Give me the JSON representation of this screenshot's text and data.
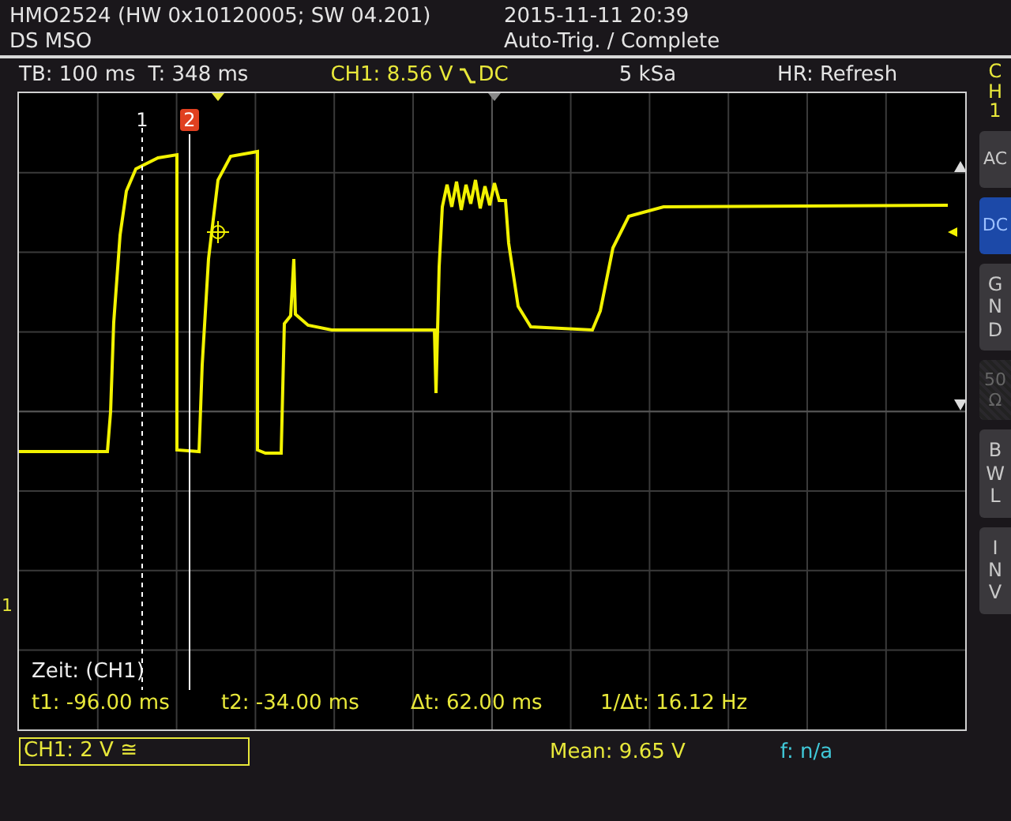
{
  "header": {
    "device": "HMO2524 (HW 0x10120005; SW 04.201)",
    "mode": "DS MSO",
    "datetime": "2015-11-11 20:39",
    "status": "Auto-Trig. / Complete"
  },
  "info_bar": {
    "timebase": "TB: 100 ms",
    "trigger_time": "T: 348 ms",
    "trigger_level": "CH1: 8.56 V",
    "trigger_coupling": "DC",
    "sample_rate": "5 kSa",
    "acquisition": "HR: Refresh"
  },
  "cursors": [
    {
      "label": "1",
      "kind": "dashed",
      "selected": false
    },
    {
      "label": "2",
      "kind": "solid",
      "selected": true
    }
  ],
  "ground_marker": "1",
  "measurements": {
    "title": "Zeit: (CH1)",
    "values": [
      "t1: -96.00 ms",
      "t2: -34.00 ms",
      "Δt: 62.00 ms",
      "1/Δt: 16.12 Hz"
    ]
  },
  "side_menu": {
    "channel": "CH1",
    "buttons": [
      {
        "label": "AC",
        "kind": "inline",
        "selected": false,
        "disabled": false
      },
      {
        "label": "DC",
        "kind": "inline",
        "selected": true,
        "disabled": false
      },
      {
        "label": "GND",
        "kind": "stacked",
        "selected": false,
        "disabled": false
      },
      {
        "label": "50Ω",
        "kind": "wrap",
        "selected": false,
        "disabled": true
      },
      {
        "label": "BWL",
        "kind": "stacked",
        "selected": false,
        "disabled": false
      },
      {
        "label": "INV",
        "kind": "stacked",
        "selected": false,
        "disabled": false
      }
    ]
  },
  "footer": {
    "channel_scale": "CH1: 2 V ≅",
    "mean": "Mean: 9.65 V",
    "frequency": "f: n/a"
  }
}
